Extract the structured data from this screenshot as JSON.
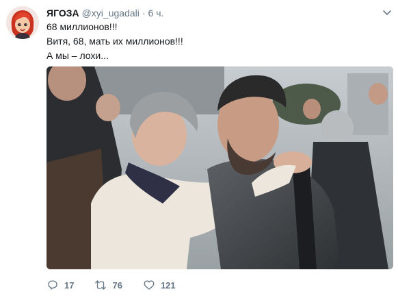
{
  "tweet": {
    "author_name": "ЯГОЗА",
    "author_handle": "@xyi_ugadali",
    "separator": "·",
    "timestamp": "6 ч.",
    "lines": [
      "68 миллионов!!!",
      "Витя, 68, мать их миллионов!!!",
      "А мы – лохи..."
    ],
    "avatar_icon": "cartoon-girl-avatar",
    "media": {
      "type": "photo",
      "description_icon": "photo-image"
    },
    "actions": {
      "reply_count": "17",
      "retweet_count": "76",
      "like_count": "121"
    }
  },
  "icons": {
    "reply": "reply-icon",
    "retweet": "retweet-icon",
    "like": "heart-icon",
    "menu": "chevron-down-icon"
  },
  "colors": {
    "text_primary": "#14171a",
    "text_secondary": "#657786",
    "avatar_hair": "#d63a2a"
  }
}
